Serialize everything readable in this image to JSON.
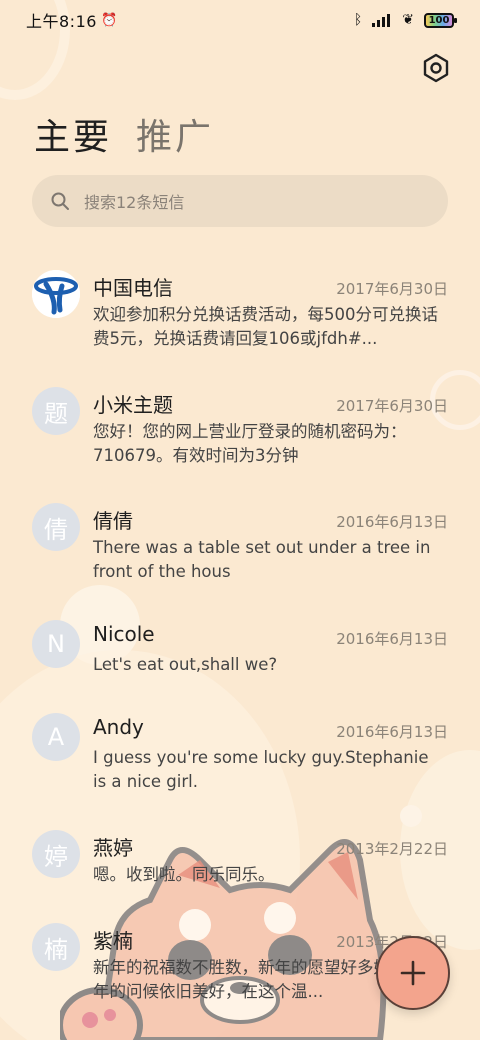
{
  "status": {
    "time": "上午8:16",
    "battery": "100"
  },
  "tabs": [
    {
      "label": "主要"
    },
    {
      "label": "推广"
    }
  ],
  "search": {
    "placeholder": "搜索12条短信"
  },
  "messages": [
    {
      "avatar": "",
      "name": "中国电信",
      "date": "2017年6月30日",
      "preview": "欢迎参加积分兑换话费活动，每500分可兑换话费5元，兑换话费请回复106或jfdh#..."
    },
    {
      "avatar": "题",
      "name": "小米主题",
      "date": "2017年6月30日",
      "preview": "您好！您的网上营业厅登录的随机密码为：710679。有效时间为3分钟"
    },
    {
      "avatar": "倩",
      "name": "倩倩",
      "date": "2016年6月13日",
      "preview": "There was a table set out under a tree in front of the hous"
    },
    {
      "avatar": "N",
      "name": "Nicole",
      "date": "2016年6月13日",
      "preview": "Let's eat out,shall we?"
    },
    {
      "avatar": "A",
      "name": "Andy",
      "date": "2016年6月13日",
      "preview": "I guess you're some lucky guy.Stephanie is a nice girl."
    },
    {
      "avatar": "婷",
      "name": "燕婷",
      "date": "2013年2月22日",
      "preview": "嗯。收到啦。同乐同乐。"
    },
    {
      "avatar": "楠",
      "name": "紫楠",
      "date": "2013年2月22日",
      "preview": "新年的祝福数不胜数，新年的愿望好多好多，新年的问候依旧美好，在这个温..."
    }
  ]
}
